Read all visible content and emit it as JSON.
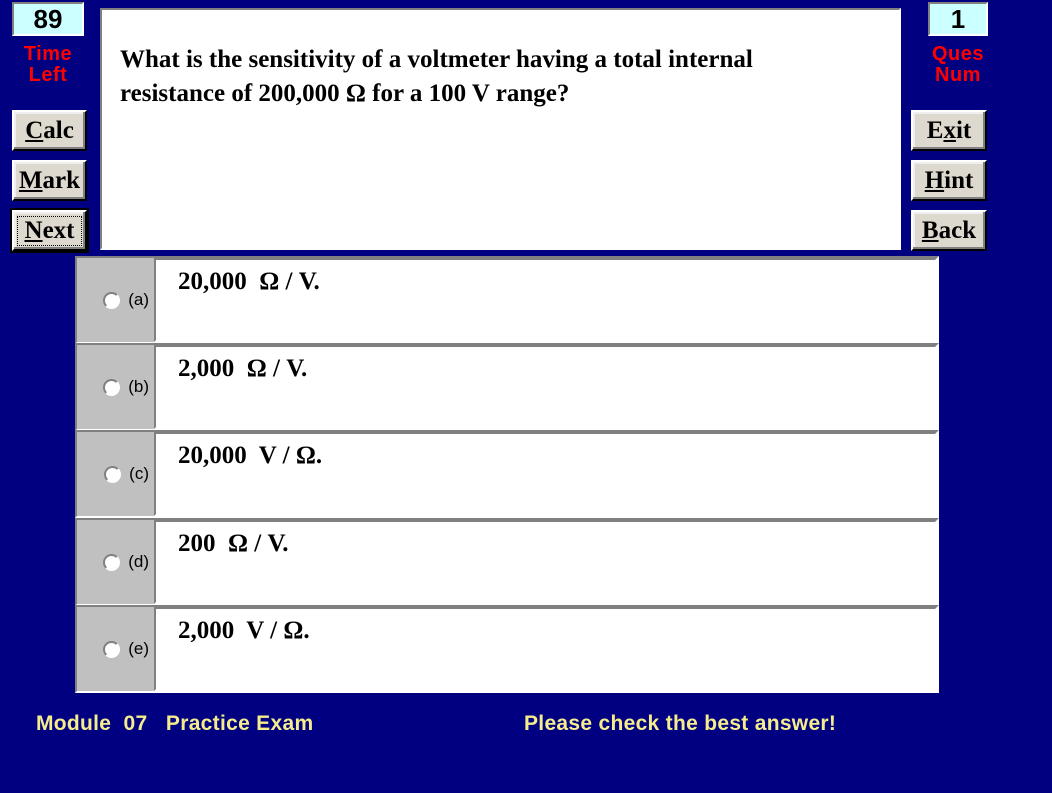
{
  "background_color": "#000080",
  "timer": {
    "value": "89",
    "label_line1": "Time",
    "label_line2": "Left",
    "label_color": "#ff0000",
    "field_color": "#ccffff"
  },
  "question_number": {
    "value": "1",
    "label_line1": "Ques",
    "label_line2": "Num",
    "label_color": "#ff0000",
    "field_color": "#ccffff"
  },
  "left_buttons": [
    {
      "id": "calc",
      "accel": "C",
      "rest": "alc",
      "name": "calc-button"
    },
    {
      "id": "mark",
      "accel": "M",
      "rest": "ark",
      "name": "mark-button"
    },
    {
      "id": "next",
      "accel": "N",
      "rest": "ext",
      "name": "next-button",
      "is_default": true
    }
  ],
  "right_buttons": [
    {
      "id": "exit",
      "pre": "E",
      "accel": "x",
      "rest": "it",
      "name": "exit-button"
    },
    {
      "id": "hint",
      "accel": "H",
      "rest": "int",
      "name": "hint-button"
    },
    {
      "id": "back",
      "accel": "B",
      "rest": "ack",
      "name": "back-button"
    }
  ],
  "question": {
    "text": "What is the sensitivity of a voltmeter having a total internal\nresistance of  200,000 Ω   for a  100 V  range?"
  },
  "options": [
    {
      "letter": "(a)",
      "text": "20,000  Ω / V."
    },
    {
      "letter": "(b)",
      "text": "2,000  Ω / V."
    },
    {
      "letter": "(c)",
      "text": "20,000  V / Ω."
    },
    {
      "letter": "(d)",
      "text": "200  Ω / V."
    },
    {
      "letter": "(e)",
      "text": "2,000  V / Ω."
    }
  ],
  "footer": {
    "left": "Module  07   Practice Exam",
    "right": "Please check the best answer!",
    "color": "#f5ed8c"
  }
}
